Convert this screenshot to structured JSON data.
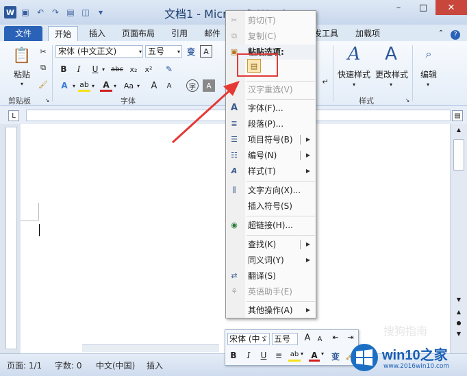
{
  "window": {
    "title": "文档1 - Microsoft Word",
    "controls": [
      "–",
      "□",
      "✕"
    ]
  },
  "tabs": [
    {
      "label": "文件"
    },
    {
      "label": "开始"
    },
    {
      "label": "插入"
    },
    {
      "label": "页面布局"
    },
    {
      "label": "引用"
    },
    {
      "label": "邮件"
    },
    {
      "label": "发工具"
    },
    {
      "label": "加载项"
    }
  ],
  "ribbon": {
    "clipboard": {
      "paste_label": "粘贴",
      "group_label": "剪贴板"
    },
    "font": {
      "font_name": "宋体 (中文正文)",
      "font_size": "五号",
      "group_label": "字体",
      "bold": "B",
      "italic": "I",
      "underline": "U",
      "strike": "abc",
      "sub": "x₂",
      "sup": "x²",
      "aa": "Aa",
      "grow": "A",
      "shrink": "A",
      "font_color": "A",
      "phonetic": "变",
      "border": "A",
      "char": "字"
    },
    "styles": {
      "quick_styles": "快速样式",
      "change_styles": "更改样式",
      "group_label": "样式"
    },
    "editing": {
      "label": "编辑"
    }
  },
  "context_menu": {
    "items": [
      {
        "label": "剪切(T)",
        "icon": "scissors-icon",
        "disabled": true
      },
      {
        "label": "复制(C)",
        "icon": "copy-icon",
        "disabled": true
      },
      {
        "label": "粘贴选项:",
        "icon": "paste-icon",
        "disabled": false,
        "header": true
      },
      {
        "label": "汉字重选(V)",
        "icon": "",
        "disabled": true
      },
      {
        "label": "字体(F)...",
        "icon": "font-icon",
        "disabled": false
      },
      {
        "label": "段落(P)...",
        "icon": "paragraph-icon",
        "disabled": false
      },
      {
        "label": "项目符号(B)",
        "icon": "bullets-icon",
        "disabled": false,
        "submenu": true,
        "split": true
      },
      {
        "label": "编号(N)",
        "icon": "numbering-icon",
        "disabled": false,
        "submenu": true,
        "split": true
      },
      {
        "label": "样式(T)",
        "icon": "styles-icon",
        "disabled": false,
        "submenu": true
      },
      {
        "label": "文字方向(X)...",
        "icon": "text-direction-icon",
        "disabled": false
      },
      {
        "label": "插入符号(S)",
        "icon": "",
        "disabled": false
      },
      {
        "label": "超链接(H)...",
        "icon": "hyperlink-icon",
        "disabled": false
      },
      {
        "label": "查找(K)",
        "icon": "",
        "disabled": false,
        "submenu": true,
        "split": true
      },
      {
        "label": "同义词(Y)",
        "icon": "",
        "disabled": false,
        "submenu": true
      },
      {
        "label": "翻译(S)",
        "icon": "translate-icon",
        "disabled": false
      },
      {
        "label": "英语助手(E)",
        "icon": "assistant-icon",
        "disabled": true
      },
      {
        "label": "其他操作(A)",
        "icon": "",
        "disabled": false,
        "submenu": true
      }
    ]
  },
  "mini_toolbar": {
    "font_name": "宋体 (中ゞ",
    "font_size": "五号",
    "bold": "B",
    "italic": "I",
    "underline": "U",
    "font_color": "A",
    "phonetic": "变"
  },
  "status_bar": {
    "page": "页面: 1/1",
    "words": "字数: 0",
    "language": "中文(中国)",
    "mode": "插入"
  },
  "watermark": {
    "brand": "win10之家",
    "url": "www.2016win10.com",
    "sogou": "搜狗指南"
  },
  "colors": {
    "accent": "#2a62b7",
    "highlight_box": "#e03a3a",
    "arrow": "#e53935"
  }
}
